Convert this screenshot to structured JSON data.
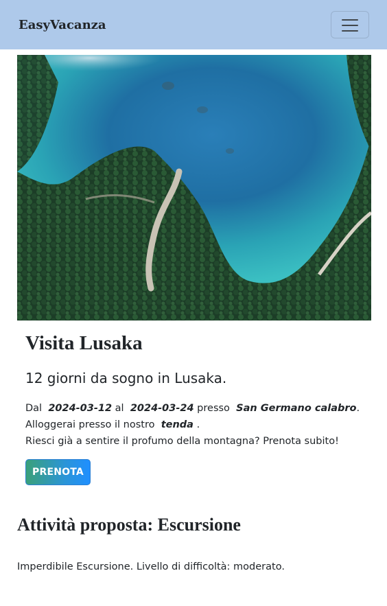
{
  "navbar": {
    "brand": "EasyVacanza",
    "menu_icon": "hamburger-menu-icon"
  },
  "hero": {
    "image_description": "Aerial view of a turquoise mountain lake surrounded by pine forest"
  },
  "trip": {
    "title_prefix": "Visita",
    "destination": "Lusaka",
    "subtitle": "12 giorni da sogno in Lusaka.",
    "dal_label": "Dal",
    "start_date": "2024-03-12",
    "al_label": "al",
    "end_date": "2024-03-24",
    "presso_label": "presso",
    "location": "San Germano calabro",
    "lodging_prefix": "Alloggerai presso il nostro",
    "lodging_type": "tenda",
    "lodging_suffix": ".",
    "call_to_action": "Riesci già a sentire il profumo della montagna? Prenota subito!",
    "book_button": "PRENOTA"
  },
  "activity": {
    "title_prefix": "Attività proposta:",
    "name": "Escursione",
    "description": "Imperdibile Escursione. Livello di difficoltà: moderato."
  },
  "colors": {
    "navbar_bg": "#aec9ea",
    "button_gradient_start": "#3aa07a",
    "button_gradient_end": "#1f8fff"
  }
}
